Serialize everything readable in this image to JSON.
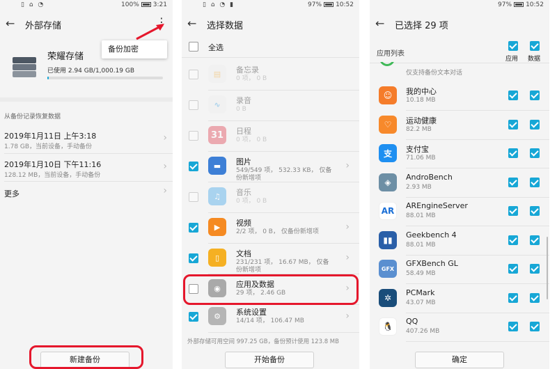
{
  "screen1": {
    "status_left": "▯ ⌂ ◔",
    "status_right": "100%",
    "status_time": "3:21",
    "title": "外部存储",
    "menu_popup": "备份加密",
    "storage_name": "荣耀存储",
    "storage_used": "已使用 2.94 GB/1,000.19 GB",
    "storage_fraction": 0.003,
    "section_title": "从备份记录恢复数据",
    "backups": [
      {
        "date": "2019年1月11日 上午3:18",
        "detail": "1.78 GB，当前设备，手动备份"
      },
      {
        "date": "2019年1月10日 下午11:16",
        "detail": "128.12 MB，当前设备，手动备份"
      }
    ],
    "more": "更多",
    "new_backup_button": "新建备份"
  },
  "screen2": {
    "status_right": "97%",
    "status_time": "10:52",
    "title": "选择数据",
    "select_all": "全选",
    "items": [
      {
        "name": "备忘录",
        "detail": "0 项， 0 B",
        "checked": false,
        "disabled": true
      },
      {
        "name": "录音",
        "detail": "0 B",
        "checked": false,
        "disabled": true
      },
      {
        "name": "日程",
        "detail": "0 项， 0 B",
        "checked": false,
        "disabled": true
      },
      {
        "name": "图片",
        "detail": "549/549 项， 532.33 KB， 仅备份新增项",
        "checked": true,
        "disabled": false
      },
      {
        "name": "音乐",
        "detail": "0 项， 0 B",
        "checked": false,
        "disabled": true
      },
      {
        "name": "视频",
        "detail": "2/2 项， 0 B， 仅备份新增项",
        "checked": true,
        "disabled": false
      },
      {
        "name": "文档",
        "detail": "231/231 项， 16.67 MB， 仅备份新增项",
        "checked": true,
        "disabled": false
      },
      {
        "name": "应用及数据",
        "detail": "29 项， 2.46 GB",
        "checked": false,
        "disabled": false
      },
      {
        "name": "系统设置",
        "detail": "14/14 项， 106.47 MB",
        "checked": true,
        "disabled": false
      }
    ],
    "calendar_day": "31",
    "footer_note": "外部存储可用空间 997.25 GB，备份预计使用 123.8 MB",
    "start_button": "开始备份"
  },
  "screen3": {
    "status_right": "97%",
    "status_time": "10:52",
    "title": "已选择 29 项",
    "list_header": "应用列表",
    "col_app": "应用",
    "col_data": "数据",
    "partial_note": "仅支持备份文本对话",
    "apps": [
      {
        "name": "我的中心",
        "size": "10.18 MB",
        "color": "#f57c2a",
        "glyph": "☺"
      },
      {
        "name": "运动健康",
        "size": "82.2 MB",
        "color": "#f7892b",
        "glyph": "♡"
      },
      {
        "name": "支付宝",
        "size": "71.06 MB",
        "color": "#1e8ff1",
        "glyph": "支"
      },
      {
        "name": "AndroBench",
        "size": "2.93 MB",
        "color": "#6d8fa5",
        "glyph": "◈"
      },
      {
        "name": "AREngineServer",
        "size": "88.01 MB",
        "color": "#ffffff",
        "glyph": "AR"
      },
      {
        "name": "Geekbench 4",
        "size": "88.01 MB",
        "color": "#2a5fa8",
        "glyph": "▮▮"
      },
      {
        "name": "GFXBench GL",
        "size": "58.49 MB",
        "color": "#5a8fd0",
        "glyph": "GFX"
      },
      {
        "name": "PCMark",
        "size": "43.07 MB",
        "color": "#1a4d7a",
        "glyph": "✲"
      },
      {
        "name": "QQ",
        "size": "407.26 MB",
        "color": "#ffffff",
        "glyph": "🐧"
      }
    ],
    "confirm_button": "确定"
  }
}
